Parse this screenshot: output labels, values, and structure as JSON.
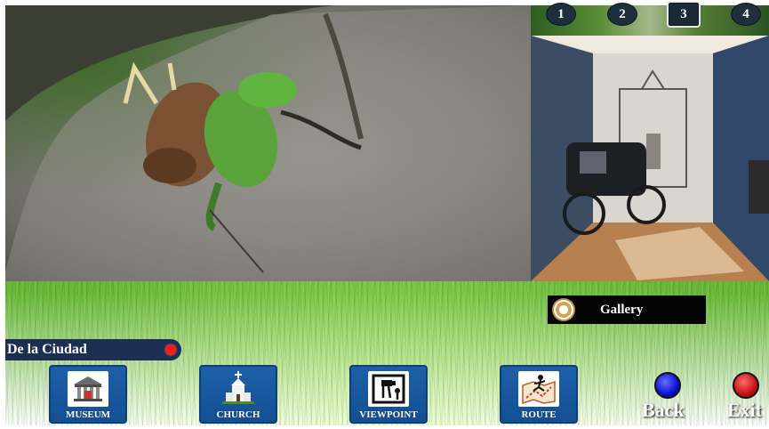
{
  "thumbnails": [
    "1",
    "2",
    "3",
    "4"
  ],
  "gallery": {
    "label": "Gallery",
    "icon": "gallery-emblem-icon"
  },
  "location": {
    "name": "De la Ciudad",
    "status_color": "#ff1a1a"
  },
  "nav": [
    {
      "id": "museum",
      "label": "MUSEUM",
      "icon": "museum-icon"
    },
    {
      "id": "church",
      "label": "CHURCH",
      "icon": "church-icon"
    },
    {
      "id": "viewpoint",
      "label": "VIEWPOINT",
      "icon": "viewpoint-icon"
    },
    {
      "id": "route",
      "label": "ROUTE",
      "icon": "route-icon"
    }
  ],
  "controls": {
    "back": {
      "label": "Back",
      "color": "#0c10d0"
    },
    "exit": {
      "label": "Exit",
      "color": "#c81212"
    }
  },
  "colors": {
    "nav_button": "#1d5fa8",
    "location_bar": "#1b2f52"
  }
}
